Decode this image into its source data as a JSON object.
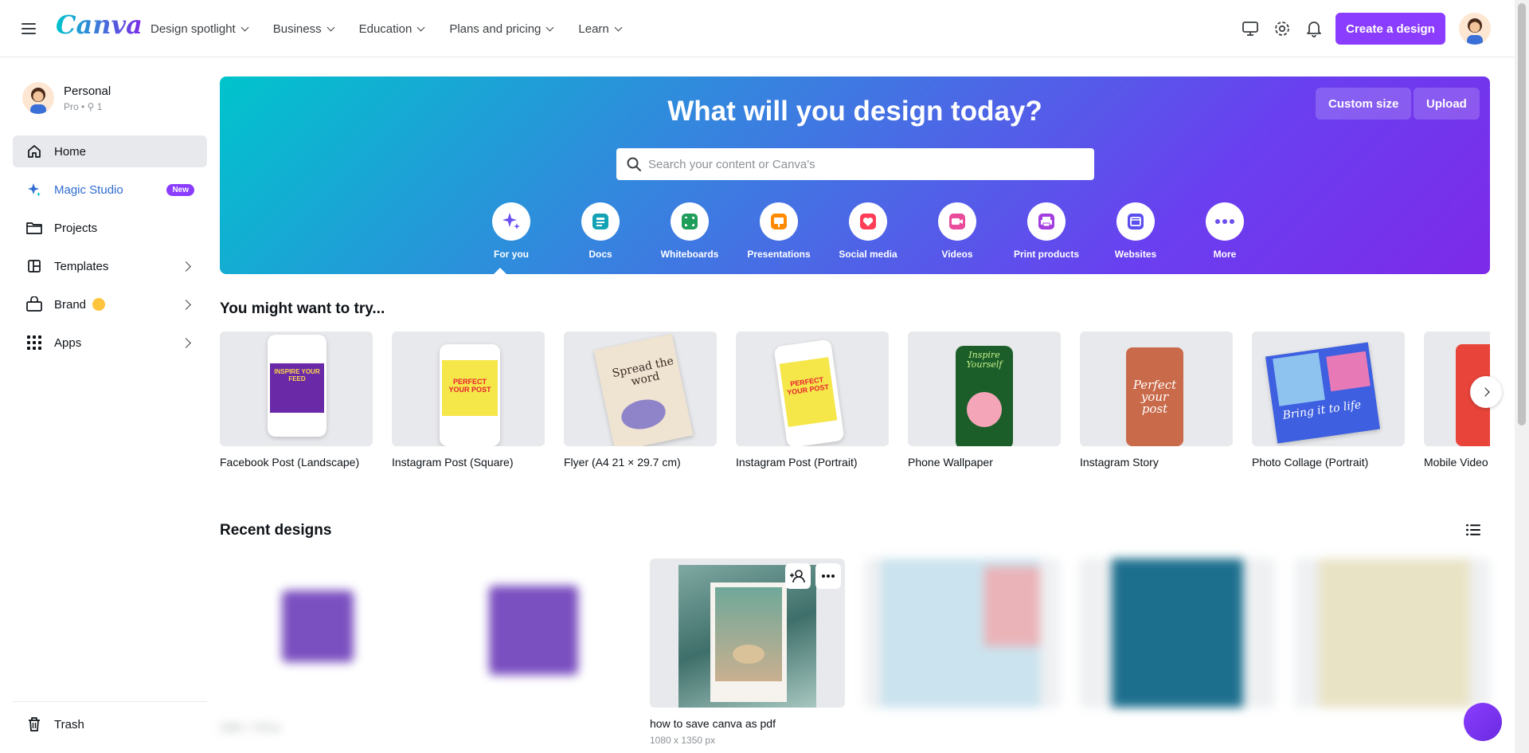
{
  "topbar": {
    "logo": "Canva",
    "nav": [
      "Design spotlight",
      "Business",
      "Education",
      "Plans and pricing",
      "Learn"
    ],
    "create_label": "Create a design"
  },
  "sidebar": {
    "account_name": "Personal",
    "account_sub": "Pro • ",
    "member_count": "1",
    "items": [
      {
        "label": "Home"
      },
      {
        "label": "Magic Studio",
        "badge": "New"
      },
      {
        "label": "Projects"
      },
      {
        "label": "Templates"
      },
      {
        "label": "Brand"
      },
      {
        "label": "Apps"
      }
    ],
    "trash_label": "Trash"
  },
  "hero": {
    "title": "What will you design today?",
    "custom_size": "Custom size",
    "upload": "Upload",
    "search_placeholder": "Search your content or Canva's",
    "categories": [
      "For you",
      "Docs",
      "Whiteboards",
      "Presentations",
      "Social media",
      "Videos",
      "Print products",
      "Websites",
      "More"
    ]
  },
  "try": {
    "title": "You might want to try...",
    "items": [
      "Facebook Post (Landscape)",
      "Instagram Post (Square)",
      "Flyer (A4 21 × 29.7 cm)",
      "Instagram Post (Portrait)",
      "Phone Wallpaper",
      "Instagram Story",
      "Photo Collage (Portrait)",
      "Mobile Video"
    ],
    "thumb_text": {
      "inspire": "INSPIRE YOUR FEED",
      "perfect": "PERFECT YOUR POST",
      "spread": "Spread the word",
      "inspire_yourself": "Inspire Yourself",
      "perfect_story": "Perfect your post",
      "bring": "Bring it to life"
    }
  },
  "recent": {
    "title": "Recent designs",
    "items": [
      {
        "name": "",
        "meta": "1080 × 720 px"
      },
      {
        "name": "",
        "meta": ""
      },
      {
        "name": "how to save canva as pdf",
        "meta": "1080 x 1350 px"
      },
      {
        "name": "",
        "meta": ""
      },
      {
        "name": "",
        "meta": ""
      },
      {
        "name": "",
        "meta": ""
      }
    ]
  },
  "colors": {
    "accent": "#8b3dff",
    "hero_start": "#00c4cc",
    "hero_end": "#7d2ae8"
  }
}
